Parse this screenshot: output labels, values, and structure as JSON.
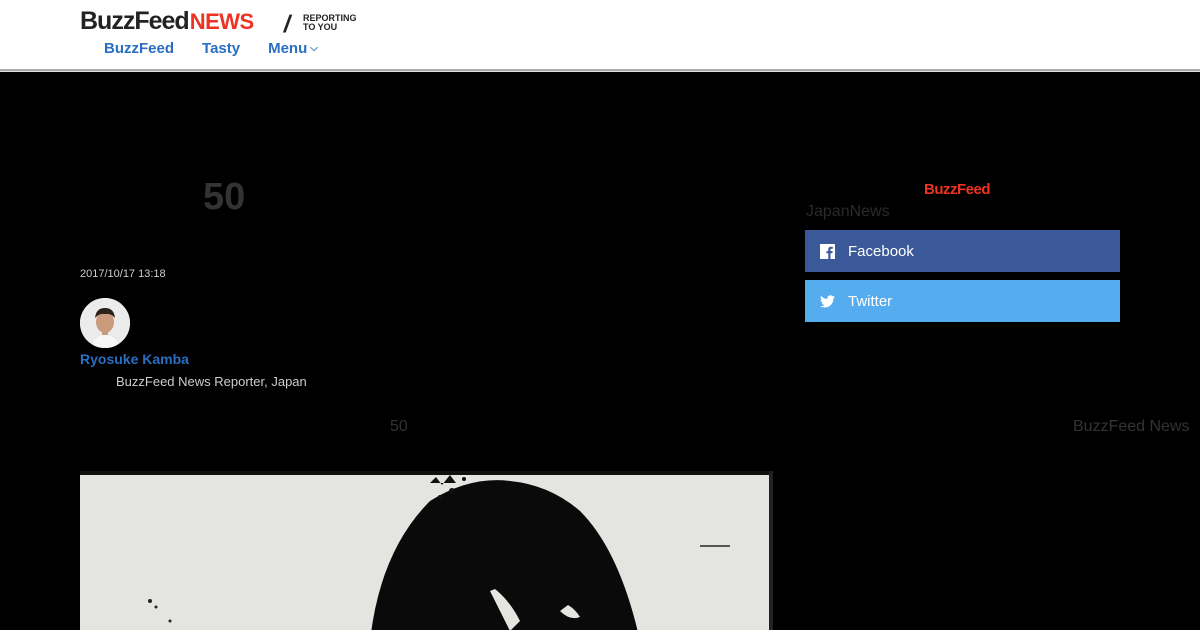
{
  "header": {
    "logo_buzzfeed": "BuzzFeed",
    "logo_news": "NEWS",
    "tagline": "REPORTING TO YOU",
    "nav": [
      {
        "label": "BuzzFeed"
      },
      {
        "label": "Tasty"
      },
      {
        "label": "Menu"
      }
    ]
  },
  "article": {
    "title": "50",
    "timestamp": "2017/10/17 13:18",
    "author_name": "Ryosuke Kamba",
    "author_role": "BuzzFeed News Reporter, Japan",
    "subheading": "50",
    "image_credit": "BuzzFeed News"
  },
  "sidebar": {
    "logo": "BuzzFeed",
    "label": "JapanNews",
    "share": [
      {
        "label": "Facebook",
        "icon": "facebook-icon",
        "color": "#3b5998"
      },
      {
        "label": "Twitter",
        "icon": "twitter-icon",
        "color": "#55acee"
      }
    ]
  },
  "colors": {
    "accent_blue": "#2a6ec2",
    "news_red": "#e32222",
    "background": "#000000"
  }
}
